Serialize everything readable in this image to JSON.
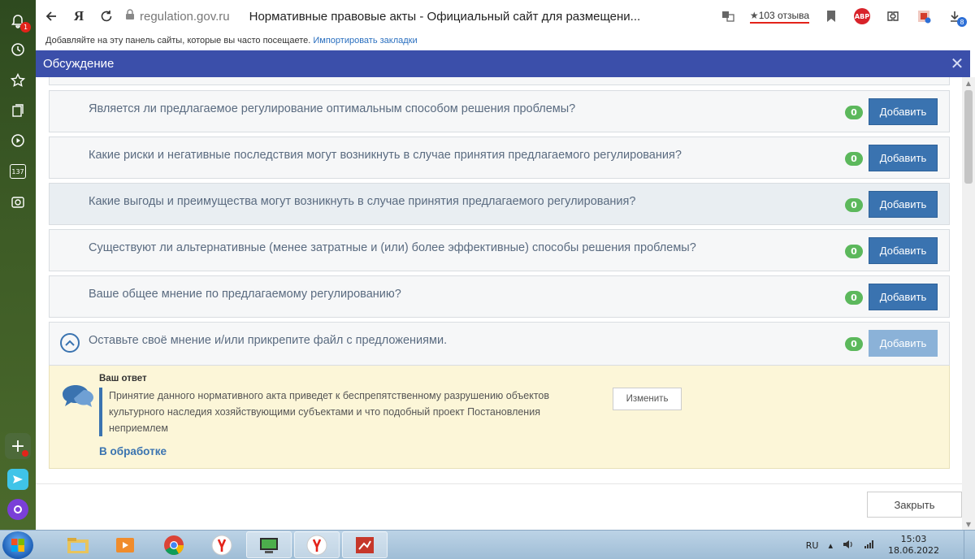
{
  "browser": {
    "url": "regulation.gov.ru",
    "page_title": "Нормативные правовые акты - Официальный сайт для размещени...",
    "reviews": "103 отзыва",
    "abp_label": "ABP",
    "download_badge": "8",
    "notification_badge": "1",
    "tab_counter": "137"
  },
  "bookmarks": {
    "prompt": "Добавляйте на эту панель сайты, которые вы часто посещаете. ",
    "import_link": "Импортировать закладки"
  },
  "modal": {
    "title": "Обсуждение",
    "close_symbol": "✕",
    "questions": [
      {
        "text": "Является ли предлагаемое регулирование оптимальным способом решения проблемы?",
        "count": "0",
        "button": "Добавить"
      },
      {
        "text": "Какие риски и негативные последствия могут возникнуть в случае принятия предлагаемого регулирования?",
        "count": "0",
        "button": "Добавить"
      },
      {
        "text": "Какие выгоды и преимущества могут возникнуть в случае принятия предлагаемого регулирования?",
        "count": "0",
        "button": "Добавить"
      },
      {
        "text": "Существуют ли альтернативные (менее затратные и (или) более эффективные) способы решения проблемы?",
        "count": "0",
        "button": "Добавить"
      },
      {
        "text": "Ваше общее мнение по предлагаемому регулированию?",
        "count": "0",
        "button": "Добавить"
      },
      {
        "text": "Оставьте своё мнение и/или прикрепите файл с предложениями.",
        "count": "0",
        "button": "Добавить"
      }
    ],
    "answer": {
      "title": "Ваш ответ",
      "text": "Принятие данного нормативного акта приведет к беспрепятственному разрушению объектов культурного наследия хозяйствующими субъектами и что подобный проект Постановления неприемлем",
      "edit_button": "Изменить",
      "status": "В обработке"
    },
    "close_button": "Закрыть"
  },
  "taskbar": {
    "lang": "RU",
    "time": "15:03",
    "date": "18.06.2022"
  },
  "colors": {
    "modal_header": "#3b4faa",
    "button_blue": "#3a73b0",
    "badge_green": "#5cb85c",
    "answer_bg": "#fcf6d8"
  }
}
